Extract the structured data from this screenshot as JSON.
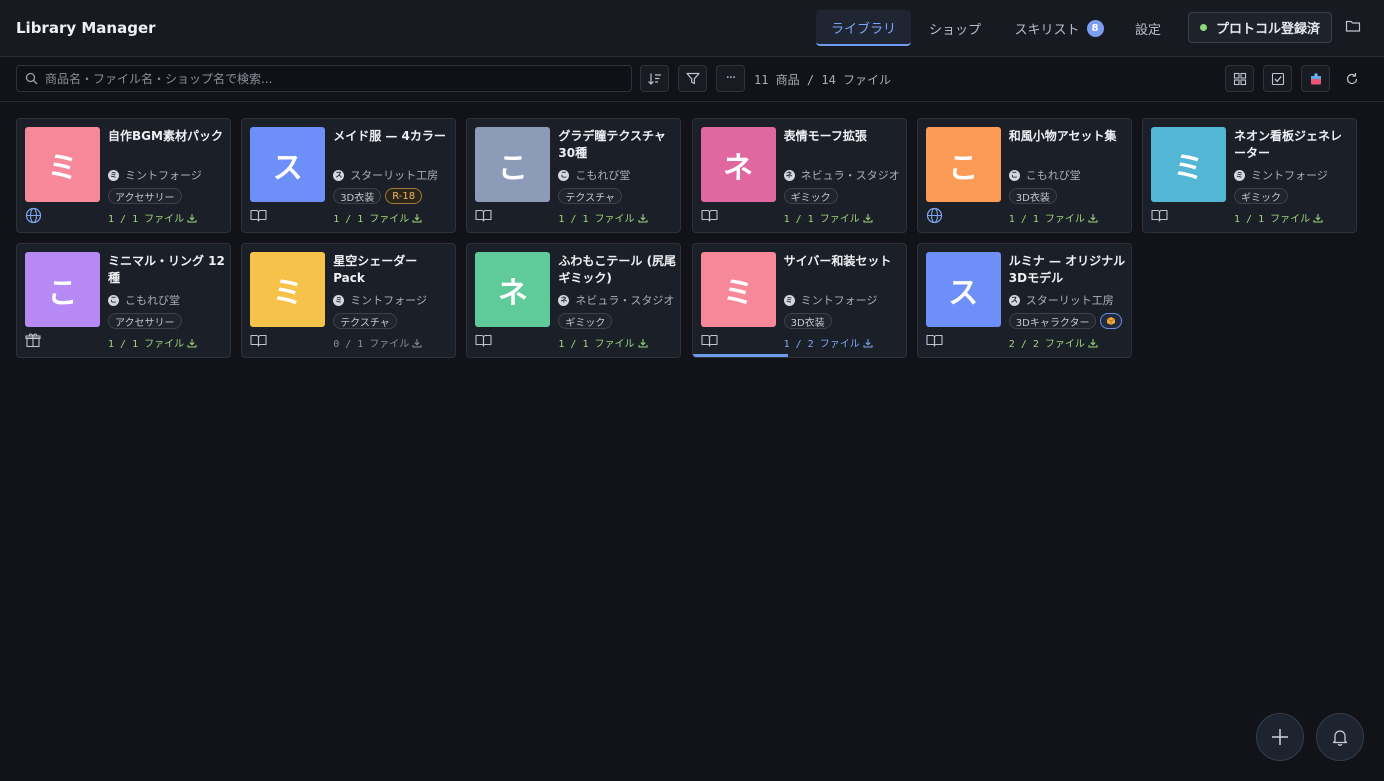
{
  "header": {
    "title": "Library Manager",
    "tabs": [
      {
        "label": "ライブラリ"
      },
      {
        "label": "ショップ"
      },
      {
        "label": "スキリスト",
        "badge": "8"
      },
      {
        "label": "設定"
      }
    ],
    "protocol_label": "プロトコル登録済",
    "protocol_status_color": "#8ed87b",
    "accent_color": "#6e9bf0"
  },
  "toolbar": {
    "search_placeholder": "商品名・ファイル名・ショップ名で検索...",
    "more_label": "···",
    "count": "11 商品 / 14 ファイル",
    "icons": [
      "sort-icon",
      "filter-icon",
      "more-icon",
      "grid-view-icon",
      "checkbox-icon",
      "box-icon",
      "reload-icon"
    ]
  },
  "items": [
    {
      "title": "自作BGM素材パック",
      "shop": "ミントフォージ",
      "shop_initial": "ミ",
      "thumb_char": "ミ",
      "thumb_color": "#f7889a",
      "tags": [
        "アクセサリー"
      ],
      "files": "1 / 1 ファイル",
      "type_icon": "globe-icon"
    },
    {
      "title": "メイド服 — 4カラー",
      "shop": "スターリット工房",
      "shop_initial": "ス",
      "thumb_char": "ス",
      "thumb_color": "#6d8ff7",
      "tags": [
        "3D衣装",
        "R-18"
      ],
      "files": "1 / 1 ファイル",
      "type_icon": "book-icon"
    },
    {
      "title": "グラデ瞳テクスチャ 30種",
      "shop": "こもれび堂",
      "shop_initial": "こ",
      "thumb_char": "こ",
      "thumb_color": "#8b9bb8",
      "tags": [
        "テクスチャ"
      ],
      "files": "1 / 1 ファイル",
      "type_icon": "book-icon"
    },
    {
      "title": "表情モーフ拡張",
      "shop": "ネビュラ・スタジオ",
      "shop_initial": "ネ",
      "thumb_char": "ネ",
      "thumb_color": "#e0679f",
      "tags": [
        "ギミック"
      ],
      "files": "1 / 1 ファイル",
      "type_icon": "book-icon"
    },
    {
      "title": "和風小物アセット集",
      "shop": "こもれび堂",
      "shop_initial": "こ",
      "thumb_char": "こ",
      "thumb_color": "#fb9b55",
      "tags": [
        "3D衣装"
      ],
      "files": "1 / 1 ファイル",
      "type_icon": "globe-icon"
    },
    {
      "title": "ネオン看板ジェネレーター",
      "shop": "ミントフォージ",
      "shop_initial": "ミ",
      "thumb_char": "ミ",
      "thumb_color": "#52b6d4",
      "tags": [
        "ギミック"
      ],
      "files": "1 / 1 ファイル",
      "type_icon": "book-icon"
    },
    {
      "title": "ミニマル・リング 12種",
      "shop": "こもれび堂",
      "shop_initial": "こ",
      "thumb_char": "こ",
      "thumb_color": "#b689f5",
      "tags": [
        "アクセサリー"
      ],
      "files": "1 / 1 ファイル",
      "type_icon": "gift-icon"
    },
    {
      "title": "星空シェーダー Pack",
      "shop": "ミントフォージ",
      "shop_initial": "ミ",
      "thumb_char": "ミ",
      "thumb_color": "#f6c249",
      "tags": [
        "テクスチャ"
      ],
      "files": "0 / 1 ファイル",
      "type_icon": "book-icon"
    },
    {
      "title": "ふわもこテール (尻尾ギミック)",
      "shop": "ネビュラ・スタジオ",
      "shop_initial": "ネ",
      "thumb_char": "ネ",
      "thumb_color": "#5fcb9b",
      "tags": [
        "ギミック"
      ],
      "files": "1 / 1 ファイル",
      "type_icon": "book-icon"
    },
    {
      "title": "サイバー和装セット",
      "shop": "ミントフォージ",
      "shop_initial": "ミ",
      "thumb_char": "ミ",
      "thumb_color": "#f7889a",
      "tags": [
        "3D衣装"
      ],
      "files": "1 / 2 ファイル",
      "type_icon": "book-icon",
      "progress": 0.45
    },
    {
      "title": "ルミナ — オリジナル3Dモデル",
      "shop": "スターリット工房",
      "shop_initial": "ス",
      "thumb_char": "ス",
      "thumb_color": "#6d8ff7",
      "tags": [
        "3Dキャラクター"
      ],
      "files": "2 / 2 ファイル",
      "type_icon": "book-icon",
      "package_badge": "box-icon"
    }
  ],
  "fabs": [
    "add-icon",
    "bell-icon"
  ]
}
